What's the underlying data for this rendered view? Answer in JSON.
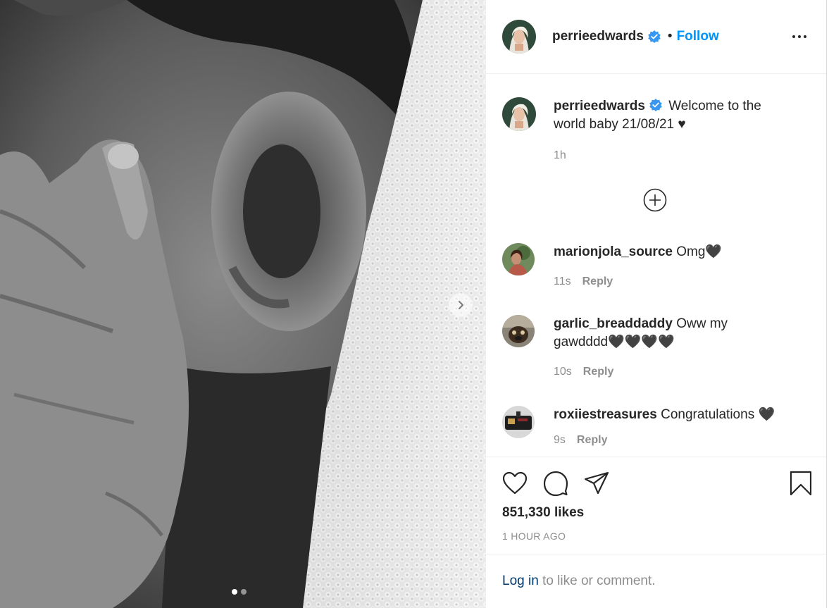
{
  "post": {
    "author": "perrieedwards",
    "follow_label": "Follow",
    "separator": "•",
    "caption_text": "Welcome to the world baby 21/08/21 ♥",
    "caption_time": "1h",
    "likes": "851,330 likes",
    "time_ago": "1 HOUR AGO",
    "carousel": {
      "current_slide": 1,
      "total_slides": 2
    }
  },
  "comments": [
    {
      "user": "marionjola_source",
      "text": "Omg🖤",
      "time": "11s",
      "reply_label": "Reply"
    },
    {
      "user": "garlic_breaddaddy",
      "text": "Oww my gawdddd🖤🖤🖤🖤",
      "time": "10s",
      "reply_label": "Reply"
    },
    {
      "user": "roxiiestreasures",
      "text": "Congratulations 🖤",
      "time": "9s",
      "reply_label": "Reply"
    }
  ],
  "login_prompt": {
    "link": "Log in",
    "rest": " to like or comment."
  },
  "icons": {
    "verified": "verified-badge-icon",
    "more": "more-options-icon",
    "load_more": "plus-circle-icon",
    "like": "heart-icon",
    "comment": "comment-icon",
    "share": "paper-plane-icon",
    "save": "bookmark-icon",
    "next": "chevron-right-icon"
  },
  "colors": {
    "accent": "#0095f6",
    "verified": "#3897f0",
    "link": "#00376b",
    "muted": "#8e8e8e"
  }
}
